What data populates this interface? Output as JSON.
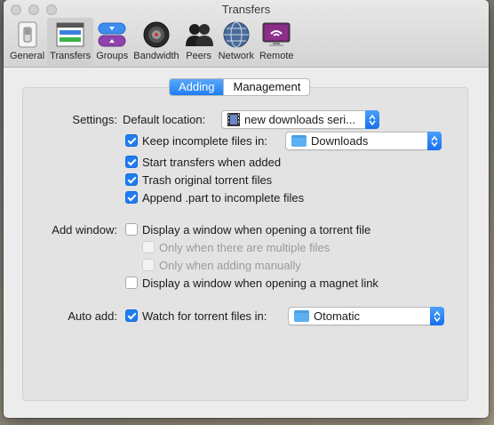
{
  "window": {
    "title": "Transfers"
  },
  "toolbar": {
    "items": [
      {
        "label": "General",
        "icon": "switch-icon"
      },
      {
        "label": "Transfers",
        "icon": "transfers-icon",
        "active": true
      },
      {
        "label": "Groups",
        "icon": "groups-icon"
      },
      {
        "label": "Bandwidth",
        "icon": "speaker-icon"
      },
      {
        "label": "Peers",
        "icon": "peers-icon"
      },
      {
        "label": "Network",
        "icon": "globe-icon"
      },
      {
        "label": "Remote",
        "icon": "monitor-icon"
      }
    ]
  },
  "tabs": {
    "adding": "Adding",
    "management": "Management",
    "selected": "Adding"
  },
  "settings": {
    "label": "Settings:",
    "default_location_label": "Default location:",
    "default_location_value": "new downloads seri...",
    "keep_incomplete": {
      "label": "Keep incomplete files in:",
      "checked": true
    },
    "incomplete_folder": "Downloads",
    "start_transfers": {
      "label": "Start transfers when added",
      "checked": true
    },
    "trash_original": {
      "label": "Trash original torrent files",
      "checked": true
    },
    "append_part": {
      "label": "Append .part to incomplete files",
      "checked": true
    }
  },
  "add_window": {
    "label": "Add window:",
    "display_torrent": {
      "label": "Display a window when opening a torrent file",
      "checked": false
    },
    "only_multiple": {
      "label": "Only when there are multiple files",
      "checked": false,
      "enabled": false
    },
    "only_manual": {
      "label": "Only when adding manually",
      "checked": false,
      "enabled": false
    },
    "display_magnet": {
      "label": "Display a window when opening a magnet link",
      "checked": false
    }
  },
  "auto_add": {
    "label": "Auto add:",
    "watch": {
      "label": "Watch for torrent files in:",
      "checked": true
    },
    "folder": "Otomatic"
  },
  "colors": {
    "accent": "#1f7cf4",
    "window_bg": "#ececec",
    "panel_bg": "#e3e3e3"
  }
}
